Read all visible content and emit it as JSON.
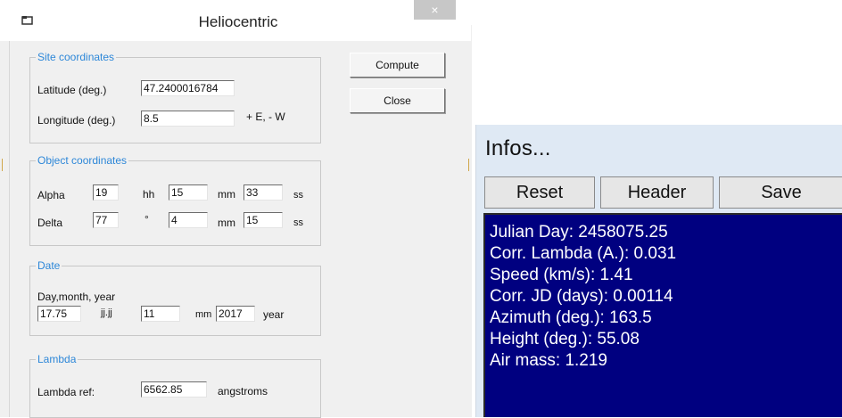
{
  "dialog": {
    "title": "Heliocentric",
    "close_glyph": "×",
    "buttons": {
      "compute": "Compute",
      "close": "Close"
    },
    "site": {
      "legend": "Site coordinates",
      "latitude_label": "Latitude (deg.)",
      "latitude_value": "47.2400016784",
      "longitude_label": "Longitude (deg.)",
      "longitude_value": "8.5",
      "longitude_hint": "+ E, - W"
    },
    "object": {
      "legend": "Object coordinates",
      "alpha_label": "Alpha",
      "alpha_hh": "19",
      "hh_unit": "hh",
      "alpha_mm": "15",
      "mm_unit": "mm",
      "alpha_ss": "33",
      "ss_unit": "ss",
      "delta_label": "Delta",
      "delta_deg": "77",
      "deg_unit": "°",
      "delta_mm": "4",
      "delta_ss": "15"
    },
    "date": {
      "legend": "Date",
      "caption": "Day,month, year",
      "day": "17.75",
      "day_unit": "jj.jj",
      "month": "11",
      "month_unit": "mm",
      "year": "2017",
      "year_unit": "year"
    },
    "lambda": {
      "legend": "Lambda",
      "label": "Lambda ref:",
      "value": "6562.85",
      "unit": "angstroms"
    }
  },
  "infos": {
    "title": "Infos...",
    "buttons": {
      "reset": "Reset",
      "header": "Header",
      "save": "Save"
    },
    "lines": [
      "Julian Day:  2458075.25",
      "Corr. Lambda (A.):  0.031",
      "Speed (km/s):  1.41",
      "Corr. JD (days):  0.00114",
      "Azimuth (deg.):  163.5",
      "Height (deg.):  55.08",
      "Air mass:  1.219"
    ]
  },
  "colors": {
    "legend_blue": "#2d87d8",
    "info_background": "#000080",
    "info_text": "#ffffff"
  }
}
